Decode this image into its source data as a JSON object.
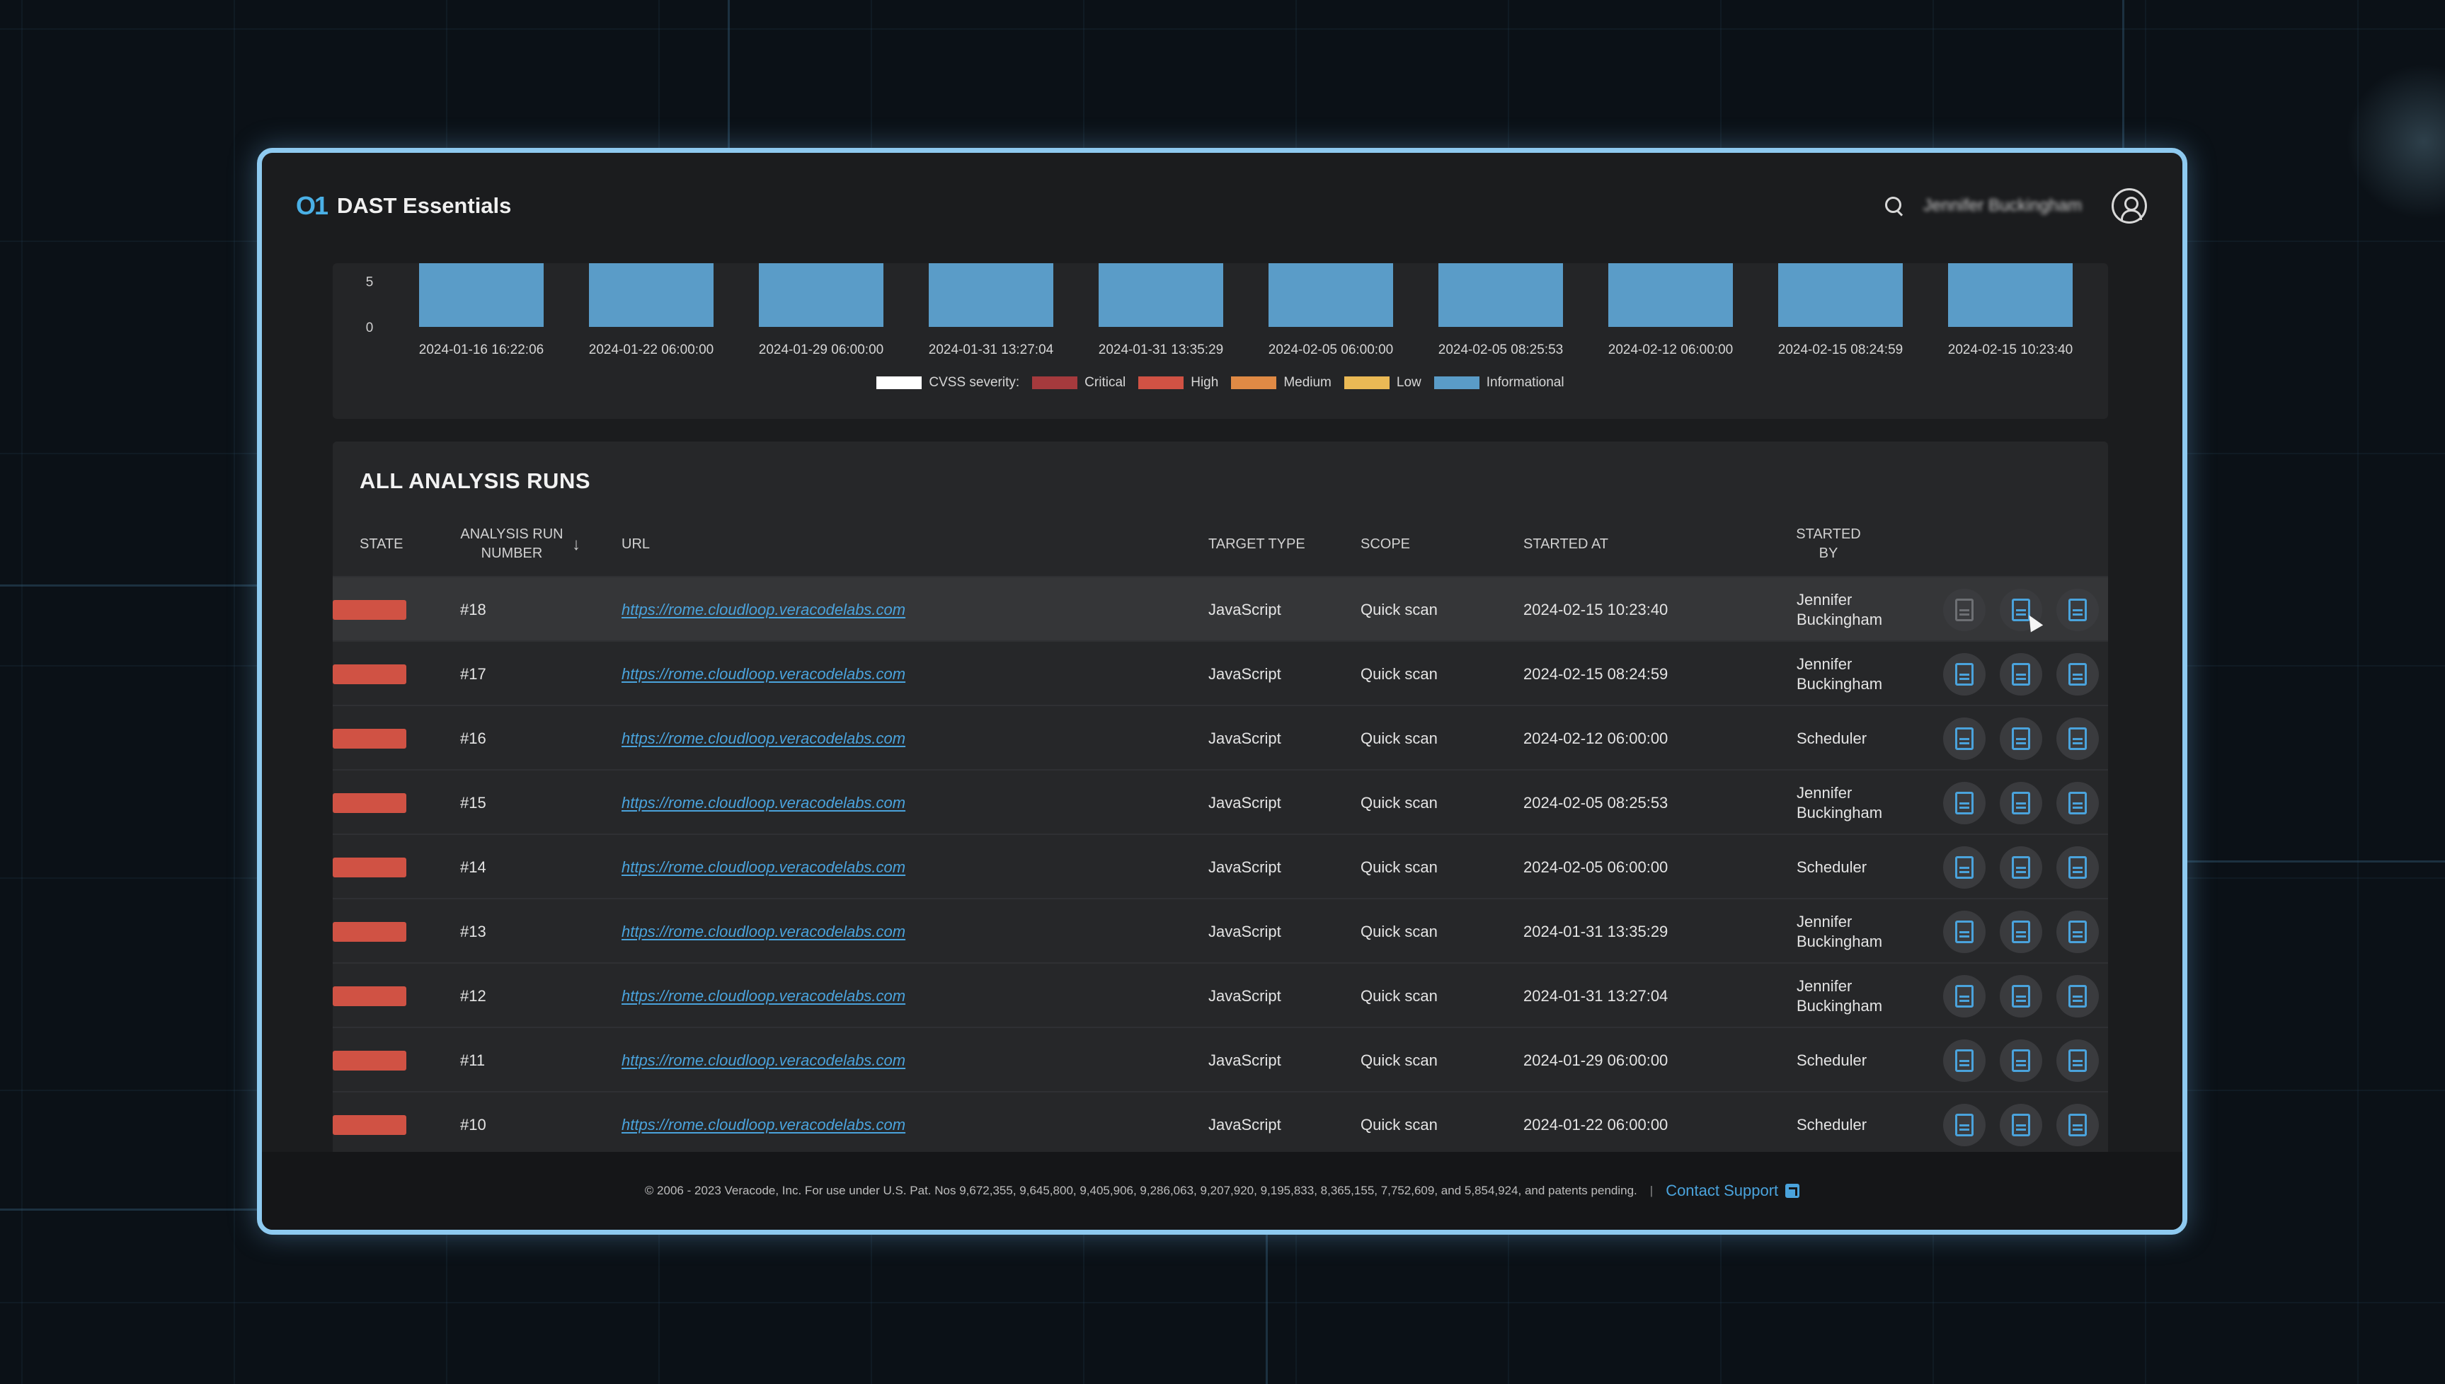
{
  "app": {
    "logo": "O1",
    "title": "DAST Essentials",
    "user_name": "Jennifer Buckingham"
  },
  "chart_data": {
    "type": "bar",
    "categories": [
      "2024-01-16 16:22:06",
      "2024-01-22 06:00:00",
      "2024-01-29 06:00:00",
      "2024-01-31 13:27:04",
      "2024-01-31 13:35:29",
      "2024-02-05 06:00:00",
      "2024-02-05 08:25:53",
      "2024-02-12 06:00:00",
      "2024-02-15 08:24:59",
      "2024-02-15 10:23:40"
    ],
    "series": [
      {
        "name": "Informational",
        "color": "#5a9cc8",
        "values": [
          7,
          7,
          7,
          7,
          7,
          7,
          7,
          7,
          7,
          7
        ]
      }
    ],
    "y_ticks": [
      "0",
      "5"
    ],
    "ylim": [
      0,
      7
    ],
    "legend": {
      "label": "CVSS severity:",
      "items": [
        {
          "name": "Critical",
          "color": "#a53a3d"
        },
        {
          "name": "High",
          "color": "#d05244"
        },
        {
          "name": "Medium",
          "color": "#e08a45"
        },
        {
          "name": "Low",
          "color": "#eab955"
        },
        {
          "name": "Informational",
          "color": "#5a9cc8"
        }
      ]
    }
  },
  "runs": {
    "title": "ALL ANALYSIS RUNS",
    "headers": {
      "state": "STATE",
      "run_number": "ANALYSIS RUN NUMBER",
      "url": "URL",
      "target_type": "TARGET TYPE",
      "scope": "SCOPE",
      "started_at": "STARTED AT",
      "started_by": "STARTED BY"
    },
    "rows": [
      {
        "number": "#18",
        "url": "https://rome.cloudloop.veracodelabs.com",
        "target_type": "JavaScript",
        "scope": "Quick scan",
        "started_at": "2024-02-15 10:23:40",
        "started_by": "Jennifer Buckingham"
      },
      {
        "number": "#17",
        "url": "https://rome.cloudloop.veracodelabs.com",
        "target_type": "JavaScript",
        "scope": "Quick scan",
        "started_at": "2024-02-15 08:24:59",
        "started_by": "Jennifer Buckingham"
      },
      {
        "number": "#16",
        "url": "https://rome.cloudloop.veracodelabs.com",
        "target_type": "JavaScript",
        "scope": "Quick scan",
        "started_at": "2024-02-12 06:00:00",
        "started_by": "Scheduler"
      },
      {
        "number": "#15",
        "url": "https://rome.cloudloop.veracodelabs.com",
        "target_type": "JavaScript",
        "scope": "Quick scan",
        "started_at": "2024-02-05 08:25:53",
        "started_by": "Jennifer Buckingham"
      },
      {
        "number": "#14",
        "url": "https://rome.cloudloop.veracodelabs.com",
        "target_type": "JavaScript",
        "scope": "Quick scan",
        "started_at": "2024-02-05 06:00:00",
        "started_by": "Scheduler"
      },
      {
        "number": "#13",
        "url": "https://rome.cloudloop.veracodelabs.com",
        "target_type": "JavaScript",
        "scope": "Quick scan",
        "started_at": "2024-01-31 13:35:29",
        "started_by": "Jennifer Buckingham"
      },
      {
        "number": "#12",
        "url": "https://rome.cloudloop.veracodelabs.com",
        "target_type": "JavaScript",
        "scope": "Quick scan",
        "started_at": "2024-01-31 13:27:04",
        "started_by": "Jennifer Buckingham"
      },
      {
        "number": "#11",
        "url": "https://rome.cloudloop.veracodelabs.com",
        "target_type": "JavaScript",
        "scope": "Quick scan",
        "started_at": "2024-01-29 06:00:00",
        "started_by": "Scheduler"
      },
      {
        "number": "#10",
        "url": "https://rome.cloudloop.veracodelabs.com",
        "target_type": "JavaScript",
        "scope": "Quick scan",
        "started_at": "2024-01-22 06:00:00",
        "started_by": "Scheduler"
      }
    ]
  },
  "footer": {
    "copyright": "© 2006 - 2023 Veracode, Inc. For use under U.S. Pat. Nos 9,672,355, 9,645,800, 9,405,906, 9,286,063, 9,207,920, 9,195,833, 8,365,155, 7,752,609, and 5,854,924, and patents pending.",
    "separator": "|",
    "support_label": "Contact Support"
  },
  "colors": {
    "accent": "#4aa3dc",
    "frame": "#8ecaf0",
    "state_failed": "#d05244"
  }
}
